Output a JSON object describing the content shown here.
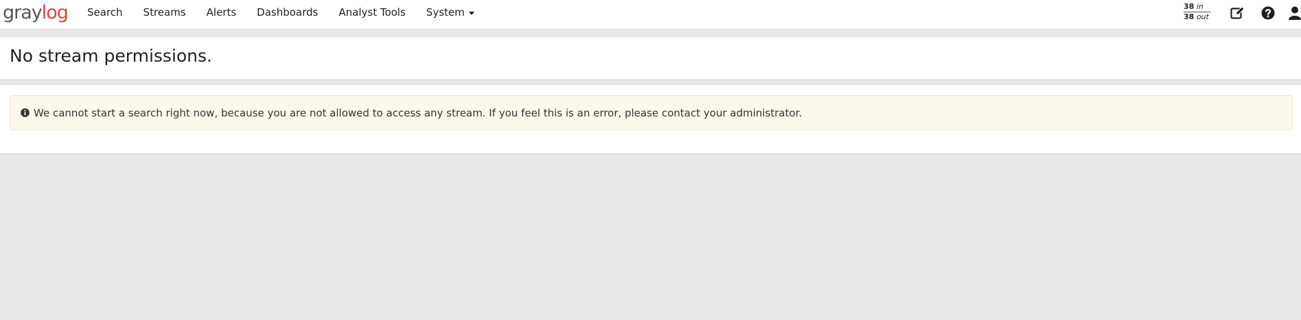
{
  "logo": {
    "part1": "gray",
    "part2": "log"
  },
  "nav": {
    "items": [
      {
        "label": "Search"
      },
      {
        "label": "Streams"
      },
      {
        "label": "Alerts"
      },
      {
        "label": "Dashboards"
      },
      {
        "label": "Analyst Tools"
      },
      {
        "label": "System"
      }
    ]
  },
  "throughput": {
    "in_count": "38",
    "in_label": "in",
    "out_count": "38",
    "out_label": "out"
  },
  "icons": {
    "notes": "edit-icon",
    "help": "question-circle-icon",
    "user": "user-icon",
    "info": "info-circle-icon"
  },
  "page": {
    "title": "No stream permissions."
  },
  "alert": {
    "message": "We cannot start a search right now, because you are not allowed to access any stream. If you feel this is an error, please contact your administrator."
  },
  "colors": {
    "brand_red": "#e0413a",
    "alert_bg": "#fcf8ec"
  }
}
